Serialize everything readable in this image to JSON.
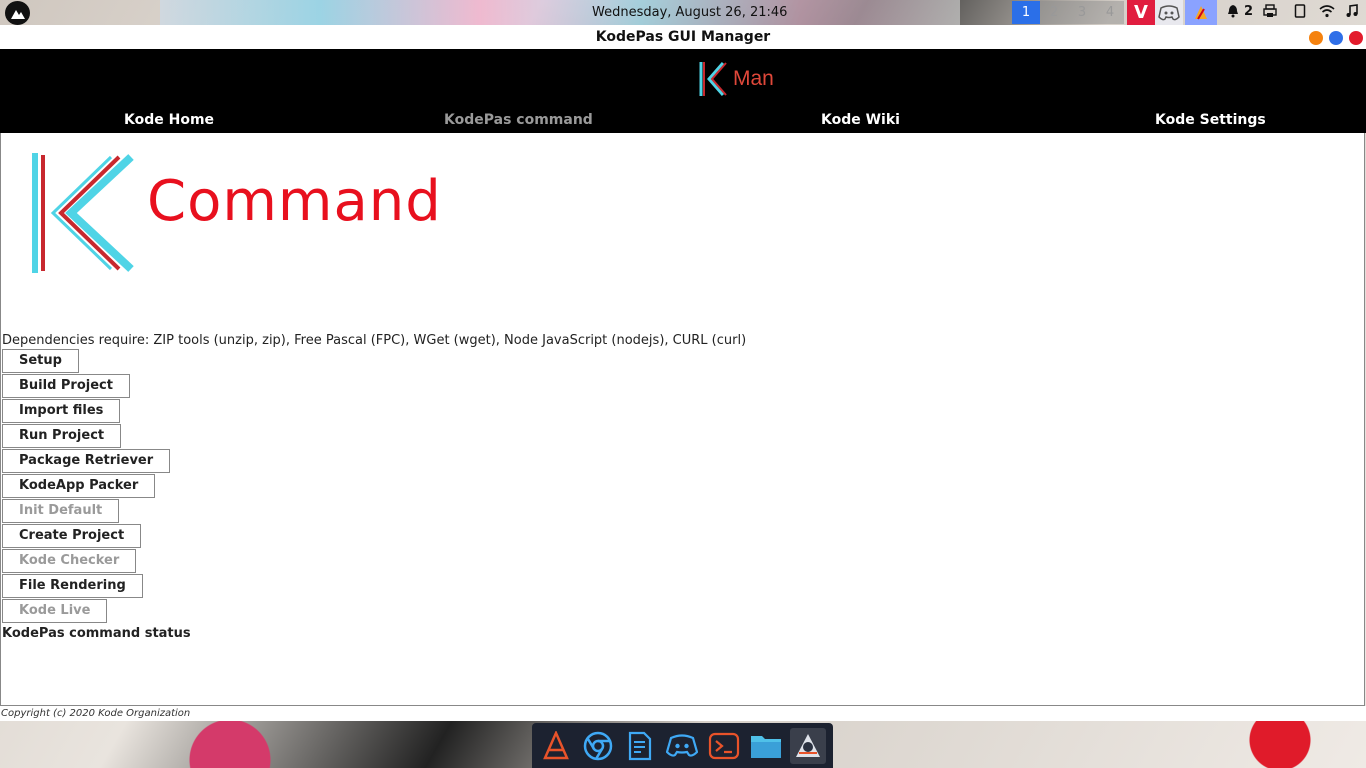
{
  "system": {
    "clock": "Wednesday, August 26, 21:46",
    "workspaces": [
      "1",
      "2",
      "3",
      "4"
    ],
    "active_workspace": "1",
    "notification_count": "2",
    "tray_apps": [
      "vivaldi-icon",
      "discord-icon",
      "kodeapp-icon"
    ],
    "tray_icons": [
      "bell-icon",
      "printer-icon",
      "tablet-icon",
      "wifi-icon",
      "music-icon"
    ]
  },
  "window": {
    "title": "KodePas GUI Manager"
  },
  "header": {
    "logo_text": "Man",
    "nav": [
      {
        "label": "Kode Home"
      },
      {
        "label": "KodePas command"
      },
      {
        "label": "Kode Wiki"
      },
      {
        "label": "Kode Settings"
      }
    ],
    "current_nav": "KodePas command"
  },
  "main": {
    "heading": "Command",
    "dependencies": "Dependencies require: ZIP tools (unzip, zip), Free Pascal (FPC), WGet (wget), Node JavaScript (nodejs), CURL (curl)",
    "buttons": [
      {
        "label": "Setup",
        "enabled": true
      },
      {
        "label": "Build Project",
        "enabled": true
      },
      {
        "label": "Import files",
        "enabled": true
      },
      {
        "label": "Run Project",
        "enabled": true
      },
      {
        "label": "Package Retriever",
        "enabled": true
      },
      {
        "label": "KodeApp Packer",
        "enabled": true
      },
      {
        "label": "Init Default",
        "enabled": false
      },
      {
        "label": "Create Project",
        "enabled": true
      },
      {
        "label": "Kode Checker",
        "enabled": false
      },
      {
        "label": "File Rendering",
        "enabled": true
      },
      {
        "label": "Kode Live",
        "enabled": false
      }
    ],
    "status": "KodePas command status"
  },
  "footer": {
    "copyright": "Copyright (c) 2020 Kode Organization"
  },
  "dock": {
    "apps": [
      "vlc-icon",
      "chrome-icon",
      "text-editor-icon",
      "discord-icon",
      "terminal-icon",
      "files-icon",
      "java-app-icon"
    ]
  },
  "colors": {
    "accent_red": "#e8101e",
    "accent_cyan": "#4fd4e6",
    "header_bg": "#000000",
    "workspace_active": "#2b6fe8"
  }
}
